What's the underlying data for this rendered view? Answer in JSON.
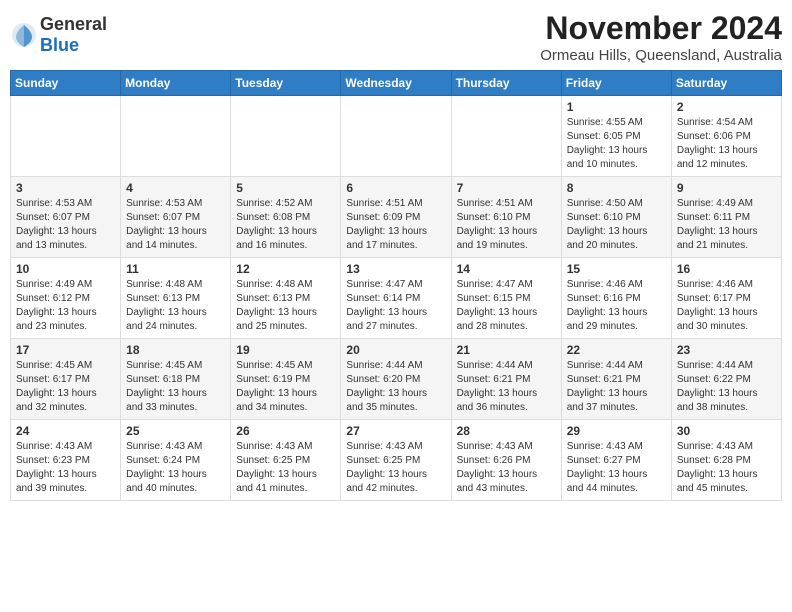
{
  "header": {
    "logo_general": "General",
    "logo_blue": "Blue",
    "month_year": "November 2024",
    "location": "Ormeau Hills, Queensland, Australia"
  },
  "weekdays": [
    "Sunday",
    "Monday",
    "Tuesday",
    "Wednesday",
    "Thursday",
    "Friday",
    "Saturday"
  ],
  "weeks": [
    [
      {
        "day": "",
        "info": ""
      },
      {
        "day": "",
        "info": ""
      },
      {
        "day": "",
        "info": ""
      },
      {
        "day": "",
        "info": ""
      },
      {
        "day": "",
        "info": ""
      },
      {
        "day": "1",
        "info": "Sunrise: 4:55 AM\nSunset: 6:05 PM\nDaylight: 13 hours and 10 minutes."
      },
      {
        "day": "2",
        "info": "Sunrise: 4:54 AM\nSunset: 6:06 PM\nDaylight: 13 hours and 12 minutes."
      }
    ],
    [
      {
        "day": "3",
        "info": "Sunrise: 4:53 AM\nSunset: 6:07 PM\nDaylight: 13 hours and 13 minutes."
      },
      {
        "day": "4",
        "info": "Sunrise: 4:53 AM\nSunset: 6:07 PM\nDaylight: 13 hours and 14 minutes."
      },
      {
        "day": "5",
        "info": "Sunrise: 4:52 AM\nSunset: 6:08 PM\nDaylight: 13 hours and 16 minutes."
      },
      {
        "day": "6",
        "info": "Sunrise: 4:51 AM\nSunset: 6:09 PM\nDaylight: 13 hours and 17 minutes."
      },
      {
        "day": "7",
        "info": "Sunrise: 4:51 AM\nSunset: 6:10 PM\nDaylight: 13 hours and 19 minutes."
      },
      {
        "day": "8",
        "info": "Sunrise: 4:50 AM\nSunset: 6:10 PM\nDaylight: 13 hours and 20 minutes."
      },
      {
        "day": "9",
        "info": "Sunrise: 4:49 AM\nSunset: 6:11 PM\nDaylight: 13 hours and 21 minutes."
      }
    ],
    [
      {
        "day": "10",
        "info": "Sunrise: 4:49 AM\nSunset: 6:12 PM\nDaylight: 13 hours and 23 minutes."
      },
      {
        "day": "11",
        "info": "Sunrise: 4:48 AM\nSunset: 6:13 PM\nDaylight: 13 hours and 24 minutes."
      },
      {
        "day": "12",
        "info": "Sunrise: 4:48 AM\nSunset: 6:13 PM\nDaylight: 13 hours and 25 minutes."
      },
      {
        "day": "13",
        "info": "Sunrise: 4:47 AM\nSunset: 6:14 PM\nDaylight: 13 hours and 27 minutes."
      },
      {
        "day": "14",
        "info": "Sunrise: 4:47 AM\nSunset: 6:15 PM\nDaylight: 13 hours and 28 minutes."
      },
      {
        "day": "15",
        "info": "Sunrise: 4:46 AM\nSunset: 6:16 PM\nDaylight: 13 hours and 29 minutes."
      },
      {
        "day": "16",
        "info": "Sunrise: 4:46 AM\nSunset: 6:17 PM\nDaylight: 13 hours and 30 minutes."
      }
    ],
    [
      {
        "day": "17",
        "info": "Sunrise: 4:45 AM\nSunset: 6:17 PM\nDaylight: 13 hours and 32 minutes."
      },
      {
        "day": "18",
        "info": "Sunrise: 4:45 AM\nSunset: 6:18 PM\nDaylight: 13 hours and 33 minutes."
      },
      {
        "day": "19",
        "info": "Sunrise: 4:45 AM\nSunset: 6:19 PM\nDaylight: 13 hours and 34 minutes."
      },
      {
        "day": "20",
        "info": "Sunrise: 4:44 AM\nSunset: 6:20 PM\nDaylight: 13 hours and 35 minutes."
      },
      {
        "day": "21",
        "info": "Sunrise: 4:44 AM\nSunset: 6:21 PM\nDaylight: 13 hours and 36 minutes."
      },
      {
        "day": "22",
        "info": "Sunrise: 4:44 AM\nSunset: 6:21 PM\nDaylight: 13 hours and 37 minutes."
      },
      {
        "day": "23",
        "info": "Sunrise: 4:44 AM\nSunset: 6:22 PM\nDaylight: 13 hours and 38 minutes."
      }
    ],
    [
      {
        "day": "24",
        "info": "Sunrise: 4:43 AM\nSunset: 6:23 PM\nDaylight: 13 hours and 39 minutes."
      },
      {
        "day": "25",
        "info": "Sunrise: 4:43 AM\nSunset: 6:24 PM\nDaylight: 13 hours and 40 minutes."
      },
      {
        "day": "26",
        "info": "Sunrise: 4:43 AM\nSunset: 6:25 PM\nDaylight: 13 hours and 41 minutes."
      },
      {
        "day": "27",
        "info": "Sunrise: 4:43 AM\nSunset: 6:25 PM\nDaylight: 13 hours and 42 minutes."
      },
      {
        "day": "28",
        "info": "Sunrise: 4:43 AM\nSunset: 6:26 PM\nDaylight: 13 hours and 43 minutes."
      },
      {
        "day": "29",
        "info": "Sunrise: 4:43 AM\nSunset: 6:27 PM\nDaylight: 13 hours and 44 minutes."
      },
      {
        "day": "30",
        "info": "Sunrise: 4:43 AM\nSunset: 6:28 PM\nDaylight: 13 hours and 45 minutes."
      }
    ]
  ]
}
